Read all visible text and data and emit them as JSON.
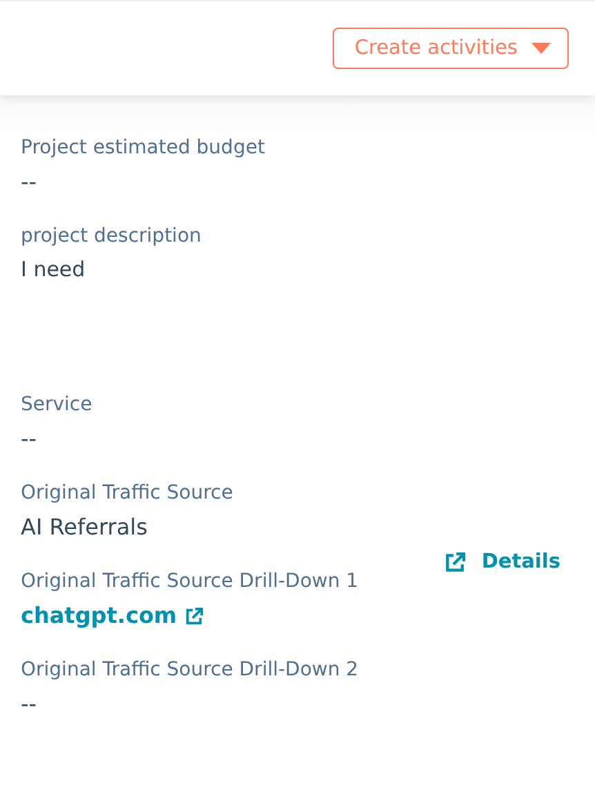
{
  "header": {
    "button": {
      "label": "Create activities"
    }
  },
  "fields": [
    {
      "label": "Project estimated budget",
      "value": "--",
      "kind": "text"
    },
    {
      "label": "project description",
      "value": "I need",
      "kind": "paragraph"
    },
    {
      "label": "Service",
      "value": "--",
      "kind": "text"
    },
    {
      "label": "Original Traffic Source",
      "value": "AI Referrals",
      "kind": "text"
    },
    {
      "label": "Original Traffic Source Drill-Down 1",
      "value": "chatgpt.com",
      "kind": "link",
      "action": "Details"
    },
    {
      "label": "Original Traffic Source Drill-Down 2",
      "value": "--",
      "kind": "text"
    }
  ]
}
